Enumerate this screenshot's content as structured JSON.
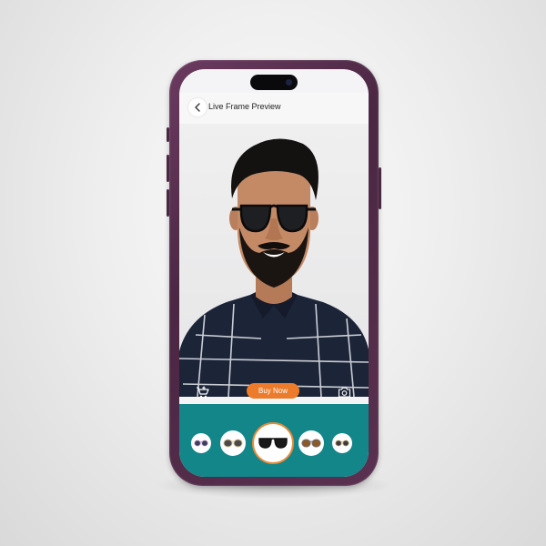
{
  "app": {
    "title": "Live Frame Preview"
  },
  "header": {
    "back_icon": "chevron-left-icon"
  },
  "camera": {
    "subject": "man wearing sunglasses"
  },
  "controls": {
    "buy_label": "Buy Now",
    "cart_icon": "add-to-cart-icon",
    "camera_icon": "camera-icon"
  },
  "tray": {
    "frames": [
      {
        "id": "frame-1",
        "lens_color": "#3a3f5a",
        "frame_color": "#b388c7"
      },
      {
        "id": "frame-2",
        "lens_color": "#4a4a4a",
        "frame_color": "#d8c59a"
      },
      {
        "id": "frame-3",
        "lens_color": "#1a1a1a",
        "frame_color": "#111111",
        "selected": true
      },
      {
        "id": "frame-4",
        "lens_color": "#8a5a2b",
        "frame_color": "#6d6d6d"
      },
      {
        "id": "frame-5",
        "lens_color": "#3d3d3d",
        "frame_color": "#c9a66b"
      }
    ]
  },
  "colors": {
    "accent": "#ec7b2b",
    "tray": "#13868a",
    "phone": "#4b2743"
  }
}
